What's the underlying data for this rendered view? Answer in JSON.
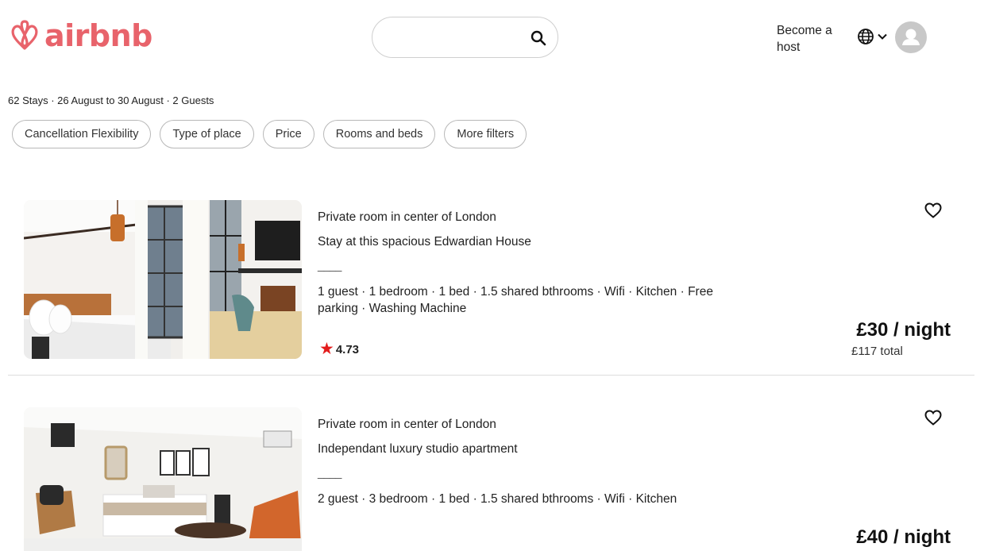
{
  "header": {
    "logo_text": "airbnb",
    "brand_color": "#e8636b",
    "search": {
      "value": "",
      "placeholder": "",
      "icon": "search-icon"
    },
    "host_label": "Become a host",
    "language_icon": "globe-icon",
    "menu_icon": "chevron-down-icon",
    "avatar_icon": "user-avatar-icon"
  },
  "summary": "62 Stays · 26 August to 30 August · 2 Guests",
  "filters": [
    "Cancellation Flexibility",
    "Type of place",
    "Price",
    "Rooms and beds",
    "More filters"
  ],
  "listings": [
    {
      "type": "Private room in center of London",
      "title": "Stay at this spacious Edwardian House",
      "separator": "____",
      "amenities": "1 guest · 1 bedroom · 1 bed · 1.5 shared bthrooms · Wifi · Kitchen · Free parking · Washing Machine",
      "rating": "4.73",
      "rating_color": "#e31c1c",
      "price": "£30 / night",
      "total": "£117 total",
      "favorite_icon": "heart-outline-icon"
    },
    {
      "type": "Private room in center of London",
      "title": "Independant luxury studio apartment",
      "separator": "____",
      "amenities": "2 guest · 3 bedroom · 1 bed · 1.5 shared bthrooms · Wifi · Kitchen",
      "price": "£40 / night",
      "favorite_icon": "heart-outline-icon"
    }
  ]
}
